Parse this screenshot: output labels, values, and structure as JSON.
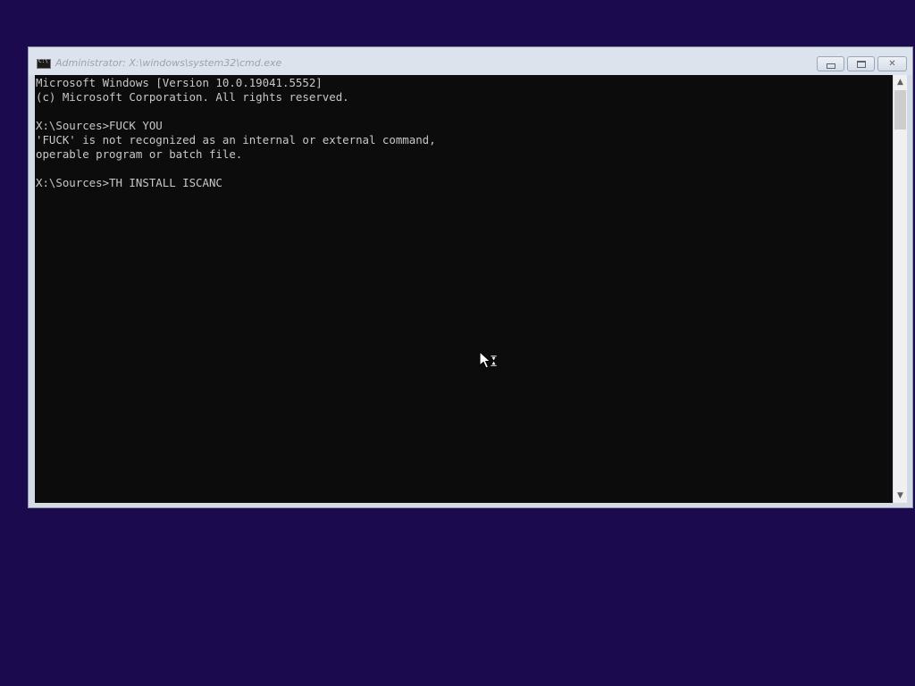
{
  "window": {
    "title": "Administrator: X:\\windows\\system32\\cmd.exe",
    "controls": {
      "minimize": "minimize",
      "maximize": "maximize",
      "close": "✕"
    }
  },
  "console": {
    "lines": [
      "Microsoft Windows [Version 10.0.19041.5552]",
      "(c) Microsoft Corporation. All rights reserved.",
      "",
      "X:\\Sources>FUCK YOU",
      "'FUCK' is not recognized as an internal or external command,",
      "operable program or batch file.",
      "",
      "X:\\Sources>TH INSTALL ISCANC"
    ]
  },
  "scrollbar": {
    "up_arrow": "▲",
    "down_arrow": "▼"
  },
  "icons": {
    "app": "cmd-icon",
    "cursor": "busy-pointer-icon"
  },
  "colors": {
    "desktop": "#1c0a4e",
    "console_bg": "#0c0c0c",
    "console_text": "#c8c8c8"
  }
}
